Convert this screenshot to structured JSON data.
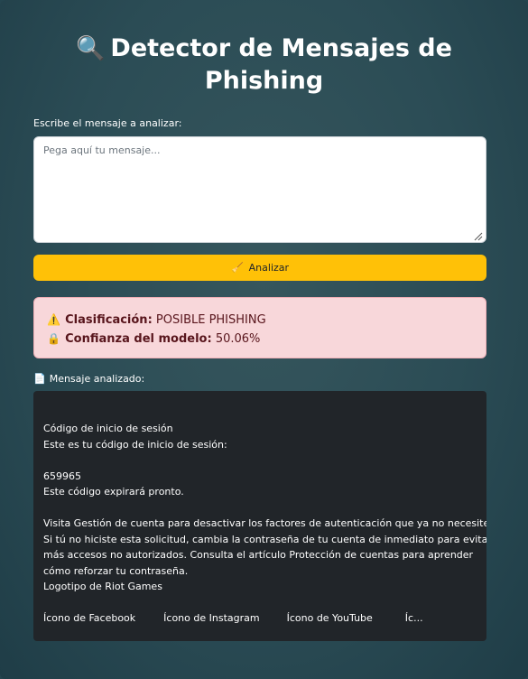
{
  "header": {
    "title_icon": "magnifier-icon",
    "title": "Detector de Mensajes de Phishing"
  },
  "input": {
    "label": "Escribe el mensaje a analizar:",
    "placeholder": "Pega aquí tu mensaje...",
    "value": ""
  },
  "analyze_button": {
    "icon": "broom-icon",
    "label": "Analizar",
    "color": "#ffc107"
  },
  "result": {
    "classification_icon": "warning-icon",
    "classification_label": "Clasificación:",
    "classification_value": "POSIBLE PHISHING",
    "confidence_icon": "lock-icon",
    "confidence_label": "Confianza del modelo:",
    "confidence_value": "50.06%",
    "background_color": "#f8d7da",
    "text_color": "#58151c"
  },
  "analyzed": {
    "icon": "document-icon",
    "label": "Mensaje analizado:",
    "lines": [
      "Código de inicio de sesión",
      "Este es tu código de inicio de sesión:",
      "",
      "659965",
      "Este código expirará pronto.",
      "",
      "Visita Gestión de cuenta para desactivar los factores de autenticación que ya no necesites.",
      "Si tú no hiciste esta solicitud, cambia la contraseña de tu cuenta de inmediato para evitar",
      "más accesos no autorizados. Consulta el artículo Protección de cuentas para aprender",
      "cómo reforzar tu contraseña.",
      "Logotipo de Riot Games",
      ""
    ],
    "icon_links": [
      "Ícono de Facebook",
      "Ícono de Instagram",
      "Ícono de YouTube",
      "Íc..."
    ]
  }
}
